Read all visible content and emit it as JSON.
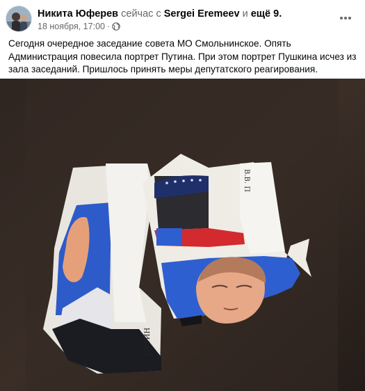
{
  "post": {
    "author": "Никита Юферев",
    "with_text": "сейчас с",
    "tagged_person": "Sergei Eremeev",
    "and_text": "и ещё",
    "others_count": "ещё 9.",
    "date": "18 ноября, 17:00",
    "separator": "·",
    "privacy_icon": "globe-icon",
    "more_icon": "more-horizontal-icon",
    "text": "Сегодня очередное заседание совета МО Смольнинское. Опять Администрация повесила портрет Путина. При этом портрет Пушкина исчез из зала заседаний. Пришлось принять меры депутатского реагирования.",
    "photo": {
      "label_top": "В.В. П",
      "label_bottom": "ПУТИН"
    }
  },
  "colors": {
    "text": "#050505",
    "muted": "#65676b",
    "photo_bg": "#2a211c"
  }
}
